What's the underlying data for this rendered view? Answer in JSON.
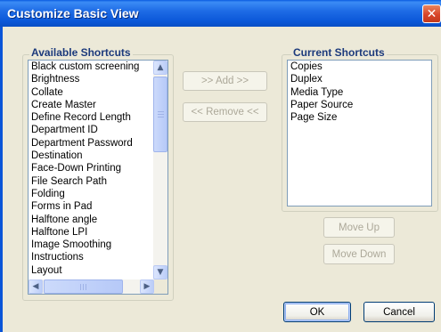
{
  "window": {
    "title": "Customize Basic View",
    "close_glyph": "✕"
  },
  "available": {
    "label": "Available Shortcuts",
    "items": [
      "Black custom screening",
      "Brightness",
      "Collate",
      "Create Master",
      "Define Record Length",
      "Department ID",
      "Department Password",
      "Destination",
      "Face-Down Printing",
      "File Search Path",
      "Folding",
      "Forms in Pad",
      "Halftone angle",
      "Halftone LPI",
      "Image Smoothing",
      "Instructions",
      "Layout"
    ]
  },
  "current": {
    "label": "Current Shortcuts",
    "items": [
      "Copies",
      "Duplex",
      "Media Type",
      "Paper Source",
      "Page Size"
    ]
  },
  "buttons": {
    "add": "&gt;&gt; Add &gt;&gt;",
    "remove": "&lt;&lt; Remove &lt;&lt;",
    "move_up": "Move Up",
    "move_down": "Move Down",
    "ok": "OK",
    "cancel": "Cancel"
  },
  "icons": {
    "scroll_up": "chevron-up-icon",
    "scroll_down": "chevron-down-icon",
    "scroll_left": "chevron-left-icon",
    "scroll_right": "chevron-right-icon"
  }
}
